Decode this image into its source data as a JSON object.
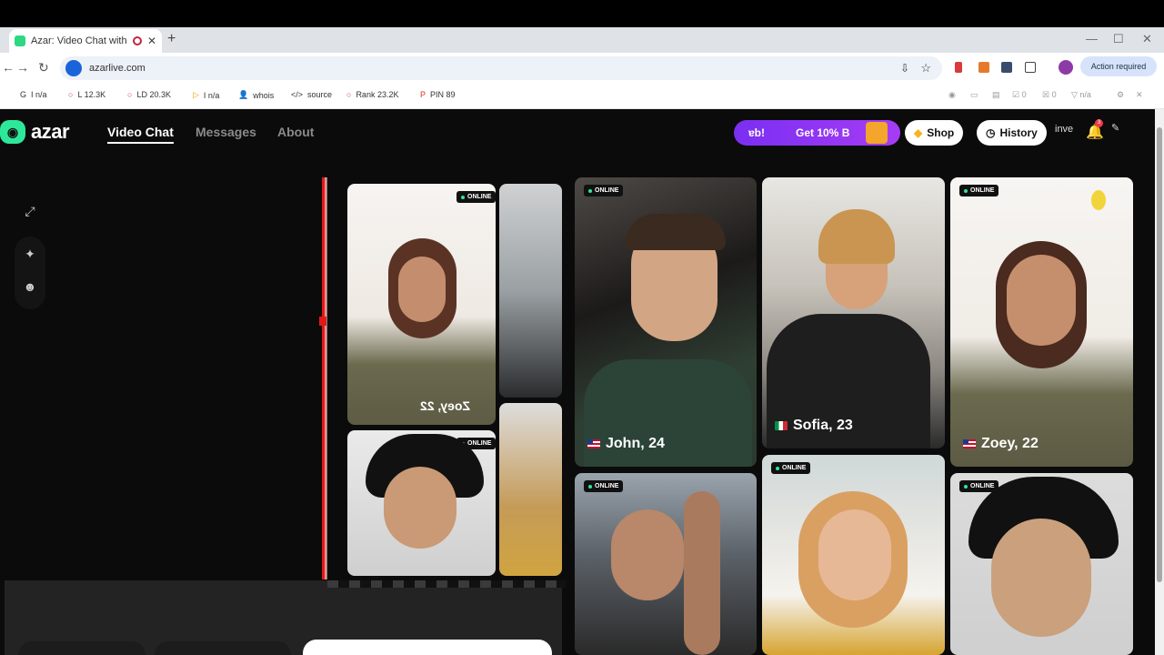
{
  "browser": {
    "tab_title": "Azar: Video Chat with New",
    "tab_close": "✕",
    "new_tab": "+",
    "url": "azarlive.com",
    "action_required": "Action required",
    "window_controls": [
      "—",
      "☐",
      "✕"
    ]
  },
  "bookmarks": [
    {
      "icon": "G",
      "label": "I n/a"
    },
    {
      "icon": "○",
      "label": "L 12.3K"
    },
    {
      "icon": "○",
      "label": "LD 20.3K"
    },
    {
      "icon": "▷",
      "label": "I n/a"
    },
    {
      "icon": "👤",
      "label": "whois"
    },
    {
      "icon": "</>",
      "label": "source"
    },
    {
      "icon": "○",
      "label": "Rank 23.2K"
    },
    {
      "icon": "P",
      "label": "PIN 89"
    }
  ],
  "bookmarks_right": [
    "0",
    "0",
    "n/a"
  ],
  "site": {
    "logo_text": "azar",
    "nav": [
      "Video Chat",
      "Messages",
      "About"
    ],
    "promo_left": "ɐb!",
    "promo_right": "Get 10% B",
    "shop": "Shop",
    "history": "History",
    "inve_alt": "inve",
    "bell_count": "3"
  },
  "online_label": "ONLINE",
  "profiles": [
    {
      "name": "John, 24",
      "flag": "us"
    },
    {
      "name": "Sofia, 23",
      "flag": "it"
    },
    {
      "name": "Zoey, 22",
      "flag": "us"
    }
  ],
  "mirrored_caption": "Zoey, 22",
  "colors": {
    "accent_green": "#2ee89a",
    "promo_purple": "#7a2ff2",
    "record_red": "#e21818"
  }
}
